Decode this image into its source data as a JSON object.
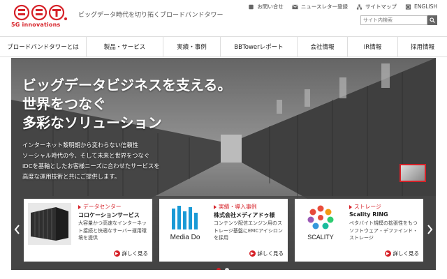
{
  "brand": {
    "logo_sub": "5G innovations",
    "tagline": "ビッグデータ時代を切り拓くブロードバンドタワー",
    "accent": "#d62128"
  },
  "utility": [
    {
      "label": "お問い合せ",
      "icon": "phone-icon"
    },
    {
      "label": "ニュースレター登録",
      "icon": "mail-icon"
    },
    {
      "label": "サイトマップ",
      "icon": "sitemap-icon"
    },
    {
      "label": "ENGLISH",
      "icon": "globe-icon"
    }
  ],
  "search": {
    "placeholder": "サイト内検索",
    "icon": "search-icon"
  },
  "nav": [
    "ブロードバンドタワーとは",
    "製品・サービス",
    "実績・事例",
    "BBTowerレポート",
    "会社情報",
    "IR情報",
    "採用情報"
  ],
  "hero": {
    "headline": [
      "ビッグデータビジネスを支える。",
      "世界をつなぐ",
      "多彩なソリューション"
    ],
    "body": [
      "インターネット黎明期から変わらない信頼性",
      "ソーシャル時代の今、そして未来と世界をつなぐ",
      "iDCを基軸としたお客様ニーズに合わせたサービスを",
      "高度な運用技術と共にご提供します。"
    ]
  },
  "cards": [
    {
      "category": "データセンター",
      "title": "コロケーションサービス",
      "desc": "大容量かつ高速なインターネット接続と快適なサーバー運用環境を提供",
      "more": "詳しく見る",
      "image": "server-rack-image"
    },
    {
      "category": "実績・導入事例",
      "title": "株式会社メディアドゥ様",
      "desc": "コンテンツ配信エンジン用のストレージ基盤にEMCアイシロンを採用",
      "more": "詳しく見る",
      "image": "media-do-logo",
      "logo_text": "Media Do"
    },
    {
      "category": "ストレージ",
      "title": "Scality RING",
      "desc": "ペタバイト規模の拡張性をもつソフトウェア・デファインド・ストレージ",
      "more": "詳しく見る",
      "image": "scality-logo",
      "logo_text": "SCALITY"
    }
  ],
  "carousel": {
    "active_index": 0,
    "count": 2
  }
}
